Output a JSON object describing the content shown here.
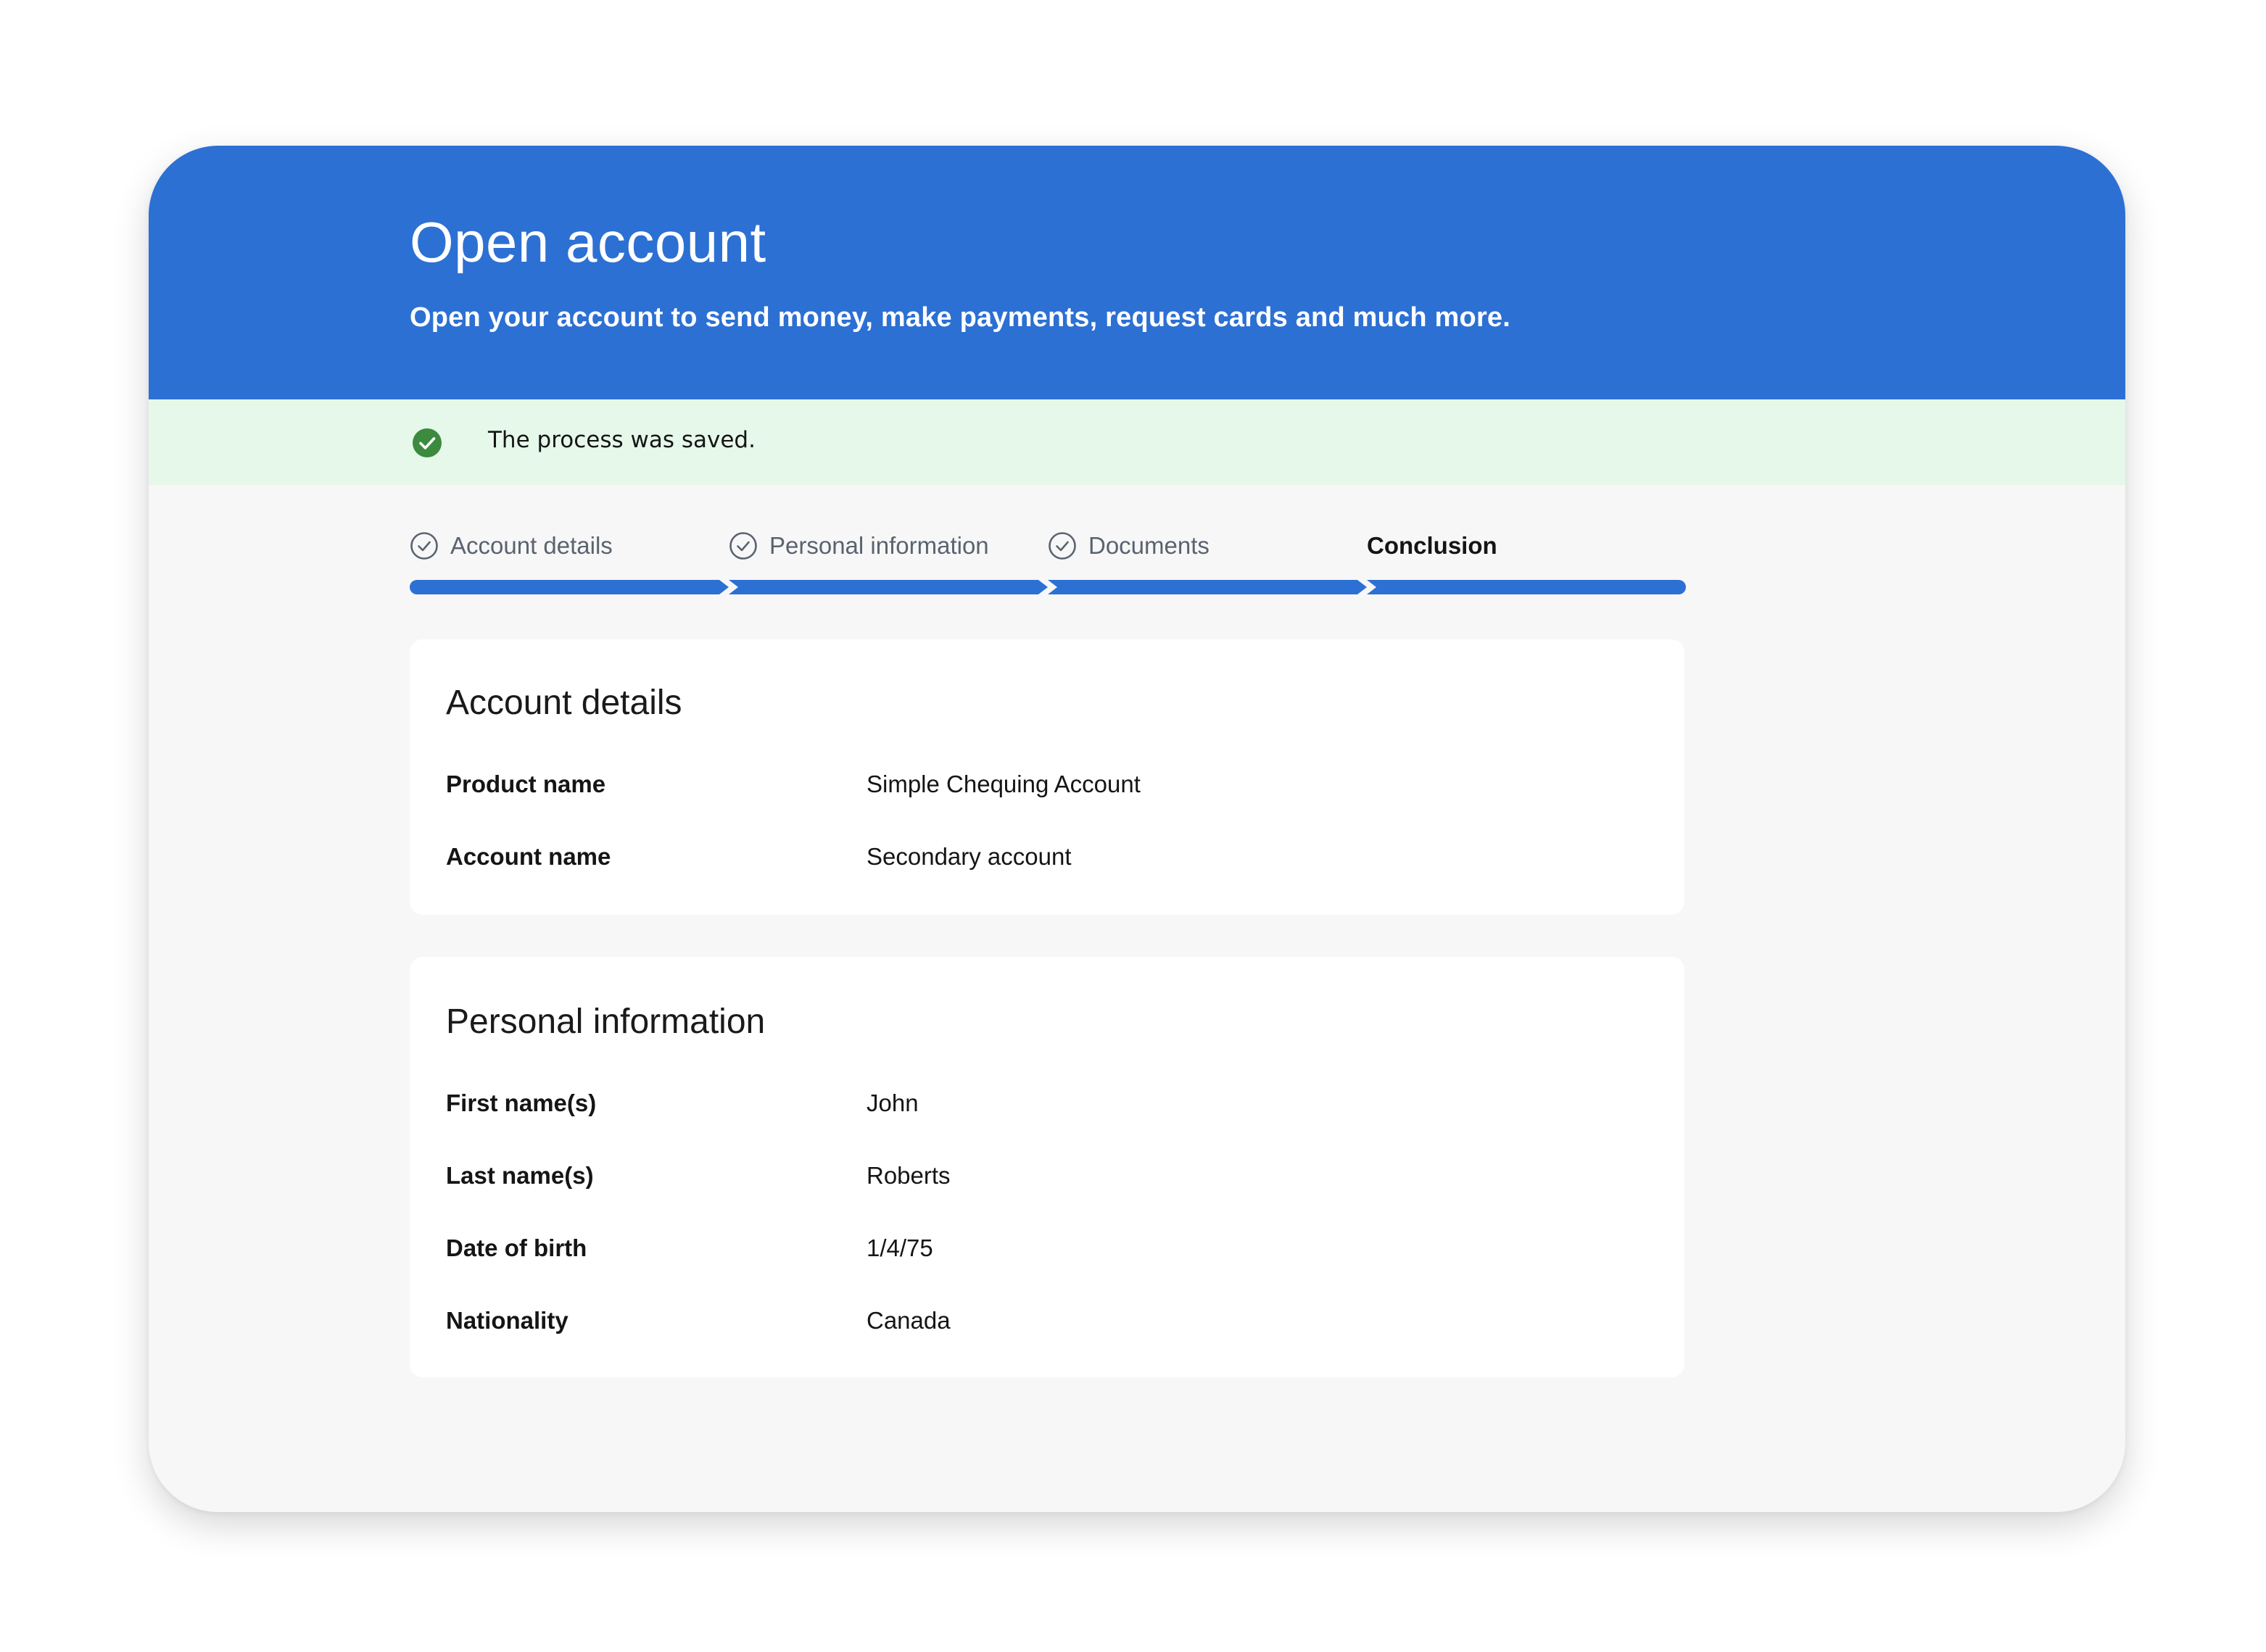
{
  "header": {
    "title": "Open account",
    "subtitle": "Open your account to send money, make payments, request cards and much more."
  },
  "banner": {
    "icon": "check-circle-filled-icon",
    "message": "The process was saved.",
    "color": "#3b8a3e"
  },
  "steps": [
    {
      "label": "Account details",
      "completed": true
    },
    {
      "label": "Personal information",
      "completed": true
    },
    {
      "label": "Documents",
      "completed": true
    },
    {
      "label": "Conclusion",
      "completed": false,
      "current": true
    }
  ],
  "account_details": {
    "title": "Account details",
    "rows": [
      {
        "label": "Product name",
        "value": "Simple Chequing Account"
      },
      {
        "label": "Account name",
        "value": "Secondary account"
      }
    ]
  },
  "personal_information": {
    "title": "Personal information",
    "rows": [
      {
        "label": "First name(s)",
        "value": "John"
      },
      {
        "label": "Last name(s)",
        "value": "Roberts"
      },
      {
        "label": "Date of birth",
        "value": "1/4/75"
      },
      {
        "label": "Nationality",
        "value": "Canada"
      }
    ]
  },
  "colors": {
    "brand": "#2c70d4",
    "success_bg": "#e6f8ea",
    "success_icon": "#3b8a3e",
    "page_bg": "#f7f7f7"
  }
}
